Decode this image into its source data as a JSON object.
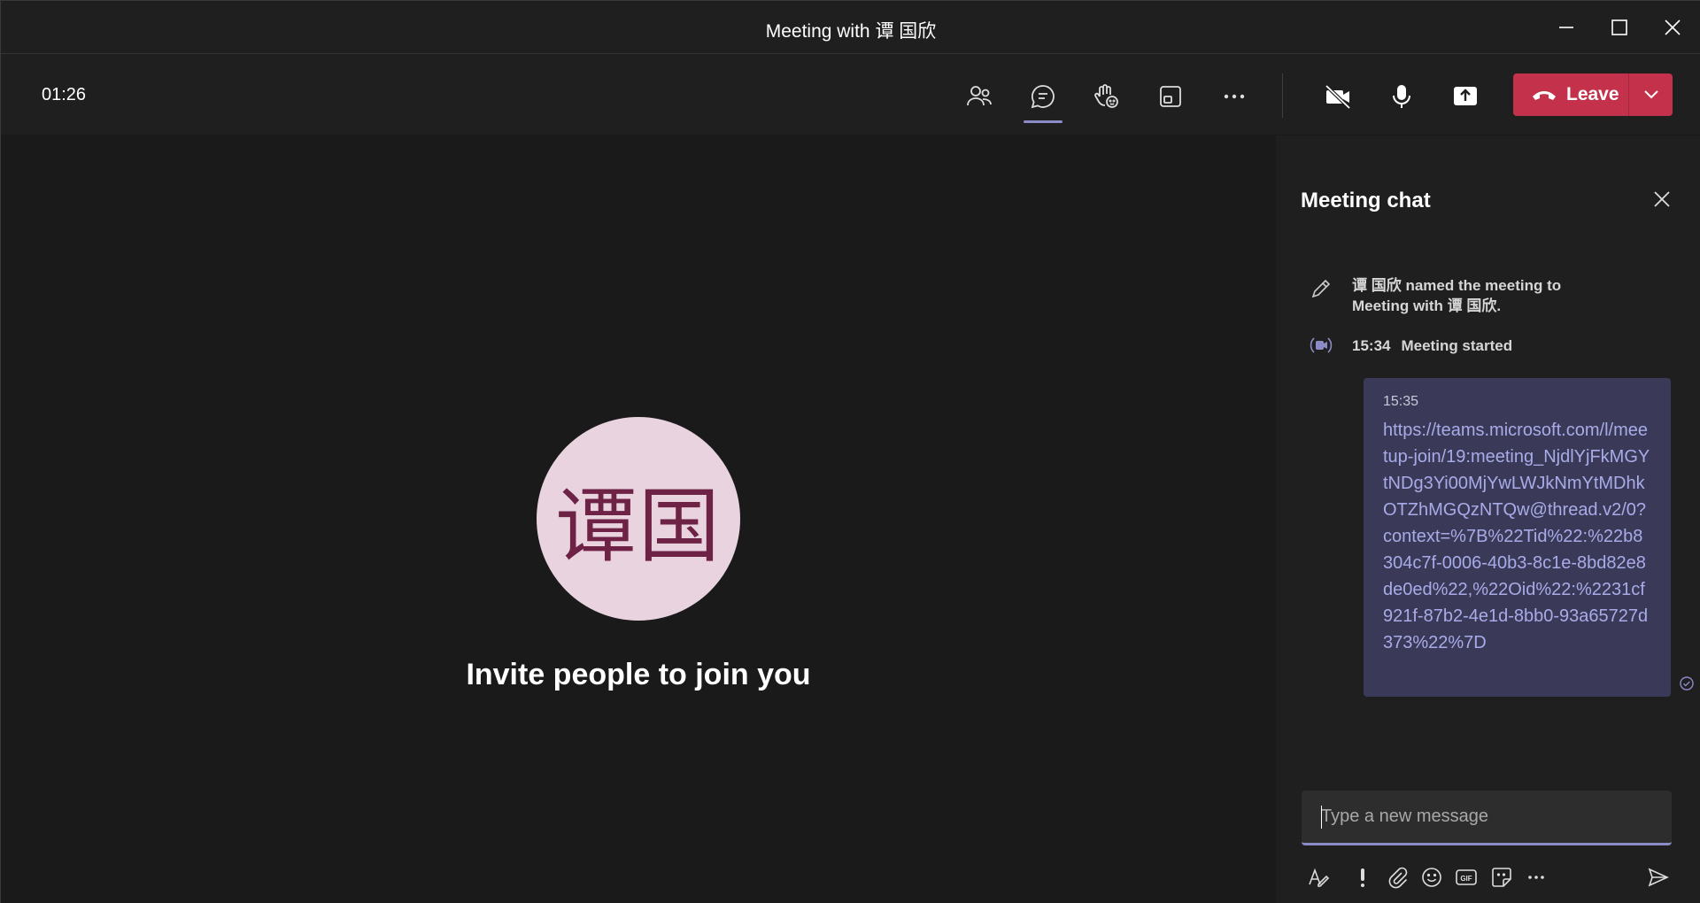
{
  "window": {
    "title": "Meeting with 谭 国欣"
  },
  "toolbar": {
    "timer": "01:26",
    "leave_label": "Leave",
    "buttons": [
      "people-icon",
      "chat-icon",
      "raise-hand-icon",
      "room-view-icon",
      "more-icon",
      "camera-off-icon",
      "mic-icon",
      "share-icon"
    ]
  },
  "stage": {
    "avatar_initials": "谭国",
    "invite_text": "Invite people to join you"
  },
  "chat": {
    "title": "Meeting chat",
    "events": [
      {
        "icon": "pencil-icon",
        "text_line1": "谭 国欣 named the meeting to",
        "text_line2": "Meeting with 谭 国欣."
      },
      {
        "icon": "meeting-video-icon",
        "time": "15:34",
        "text": "Meeting started"
      }
    ],
    "message": {
      "time": "15:35",
      "link": "https://teams.microsoft.com/l/meetup-join/19:meeting_NjdlYjFkMGYtNDg3Yi00MjYwLWJkNmYtMDhkOTZhMGQzNTQw@thread.v2/0?context=%7B%22Tid%22:%22b8304c7f-0006-40b3-8c1e-8bd82e8de0ed%22,%22Oid%22:%2231cf921f-87b2-4e1d-8bb0-93a65727d373%22%7D"
    },
    "compose_placeholder": "Type a new message",
    "format_tools": [
      "format-icon",
      "important-icon",
      "attach-icon",
      "emoji-icon",
      "gif-icon",
      "sticker-icon",
      "more-icon",
      "send-icon"
    ]
  },
  "colors": {
    "accent": "#8b8cc7",
    "leave": "#c4314b",
    "message_bubble": "#3a3a58",
    "avatar_bg": "#e8d3df",
    "avatar_fg": "#6d2246"
  }
}
